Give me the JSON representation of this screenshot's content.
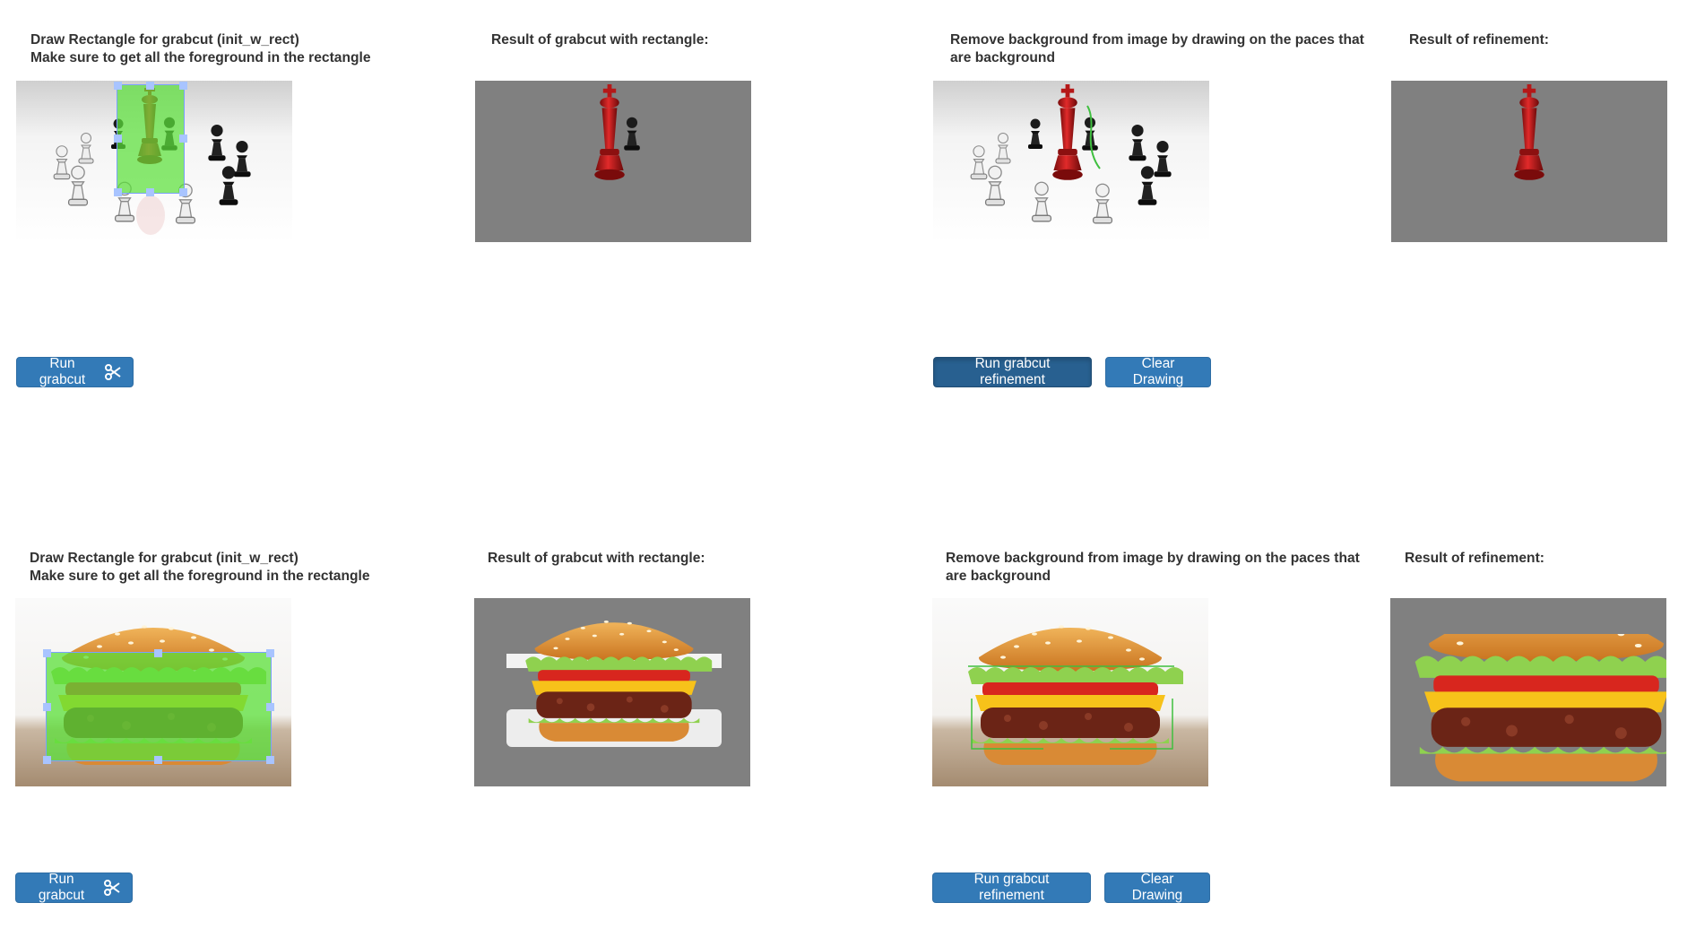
{
  "rows": [
    {
      "col1_label": "Draw Rectangle for grabcut (init_w_rect)\nMake sure to get all the foreground in the rectangle",
      "col2_label": "Result of grabcut with rectangle:",
      "col3_label": "Remove background from image by drawing on the paces that\nare background",
      "col4_label": "Result of refinement:",
      "run_grabcut": "Run grabcut",
      "run_refinement": "Run grabcut refinement",
      "clear_drawing": "Clear Drawing"
    },
    {
      "col1_label": "Draw Rectangle for grabcut (init_w_rect)\nMake sure to get all the foreground in the rectangle",
      "col2_label": "Result of grabcut with rectangle:",
      "col3_label": "Remove background from image by drawing on the paces that\nare background",
      "col4_label": "Result of refinement:",
      "run_grabcut": "Run grabcut",
      "run_refinement": "Run grabcut refinement",
      "clear_drawing": "Clear Drawing"
    }
  ],
  "icons": {
    "run_grabcut": "scissors-icon"
  },
  "colors": {
    "button_primary": "#337ab7",
    "button_active": "#286090",
    "result_background": "#808080",
    "selection_overlay": "#5be03a",
    "selection_handle": "#a8c4ff"
  }
}
